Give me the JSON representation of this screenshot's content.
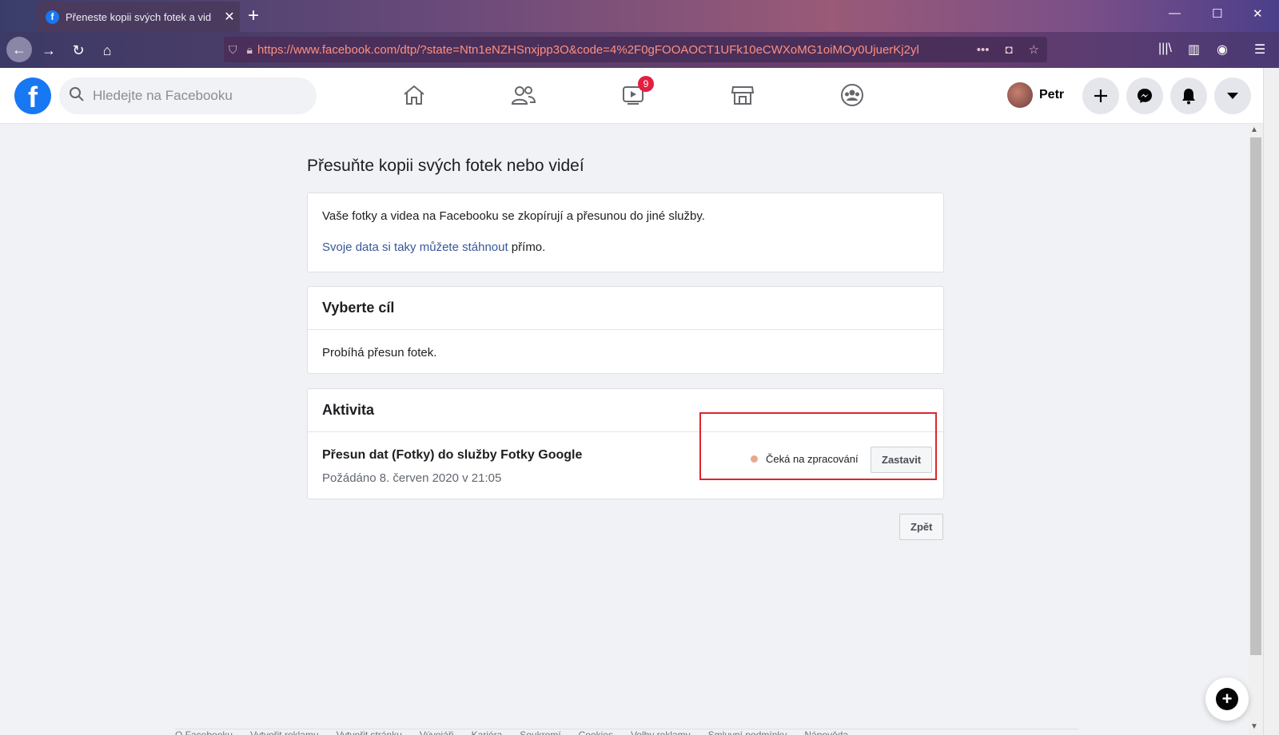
{
  "browser": {
    "tab_title": "Přeneste kopii svých fotek a vid",
    "url": "https://www.facebook.com/dtp/?state=Ntn1eNZHSnxjpp3O&code=4%2F0gFOOAOCT1UFk10eCWXoMG1oiMOy0UjuerKj2yl",
    "url_more": "•••"
  },
  "header": {
    "search_placeholder": "Hledejte na Facebooku",
    "watch_badge": "9",
    "profile_name": "Petr"
  },
  "page": {
    "title": "Přesuňte kopii svých fotek nebo videí",
    "intro_text": "Vaše fotky a videa na Facebooku se zkopírují a přesunou do jiné služby.",
    "download_link": "Svoje data si taky můžete stáhnout",
    "download_suffix": " přímo.",
    "destination_header": "Vyberte cíl",
    "destination_text": "Probíhá přesun fotek.",
    "activity_header": "Aktivita",
    "activity_title": "Přesun dat (Fotky) do služby Fotky Google",
    "activity_requested": "Požádáno 8. červen 2020 v 21:05",
    "activity_status": "Čeká na zpracování",
    "stop_button": "Zastavit",
    "back_button": "Zpět"
  },
  "footer": {
    "links": [
      "O Facebooku",
      "Vytvořit reklamu",
      "Vytvořit stránku",
      "Vývojáři",
      "Kariéra",
      "Soukromí",
      "Cookies",
      "Volby reklamy",
      "Smluvní podmínky",
      "Nápověda"
    ]
  },
  "colors": {
    "fb_blue": "#1877f2",
    "link": "#385898",
    "badge_red": "#e41e3f",
    "highlight_box": "#d9272e"
  }
}
